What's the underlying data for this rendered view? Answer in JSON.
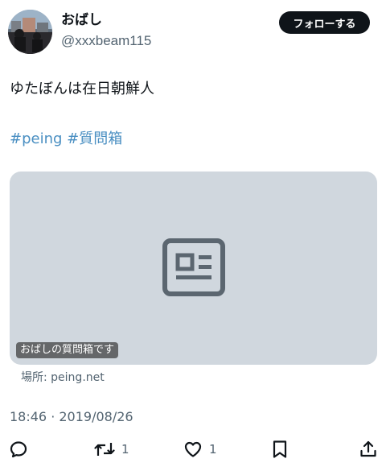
{
  "author": {
    "display_name": "おばし",
    "handle": "@xxxbeam115"
  },
  "follow_button": {
    "label": "フォローする"
  },
  "tweet": {
    "text": "ゆたぼんは在日朝鮮人",
    "hashtags": [
      "#peing",
      "#質問箱"
    ]
  },
  "card": {
    "caption": "おばしの質問箱です",
    "domain": "場所: peing.net",
    "icon": "article-icon"
  },
  "timestamp": "18:46 · 2019/08/26",
  "actions": {
    "reply": {
      "icon": "reply-icon"
    },
    "retweet": {
      "icon": "retweet-icon",
      "count": "1"
    },
    "like": {
      "icon": "heart-icon",
      "count": "1"
    },
    "bookmark": {
      "icon": "bookmark-icon"
    },
    "share": {
      "icon": "share-icon"
    }
  },
  "colors": {
    "hashtag": "#4a8fc2",
    "button_bg": "#0f1419",
    "card_bg": "#d0d7de",
    "secondary_text": "#536471"
  }
}
